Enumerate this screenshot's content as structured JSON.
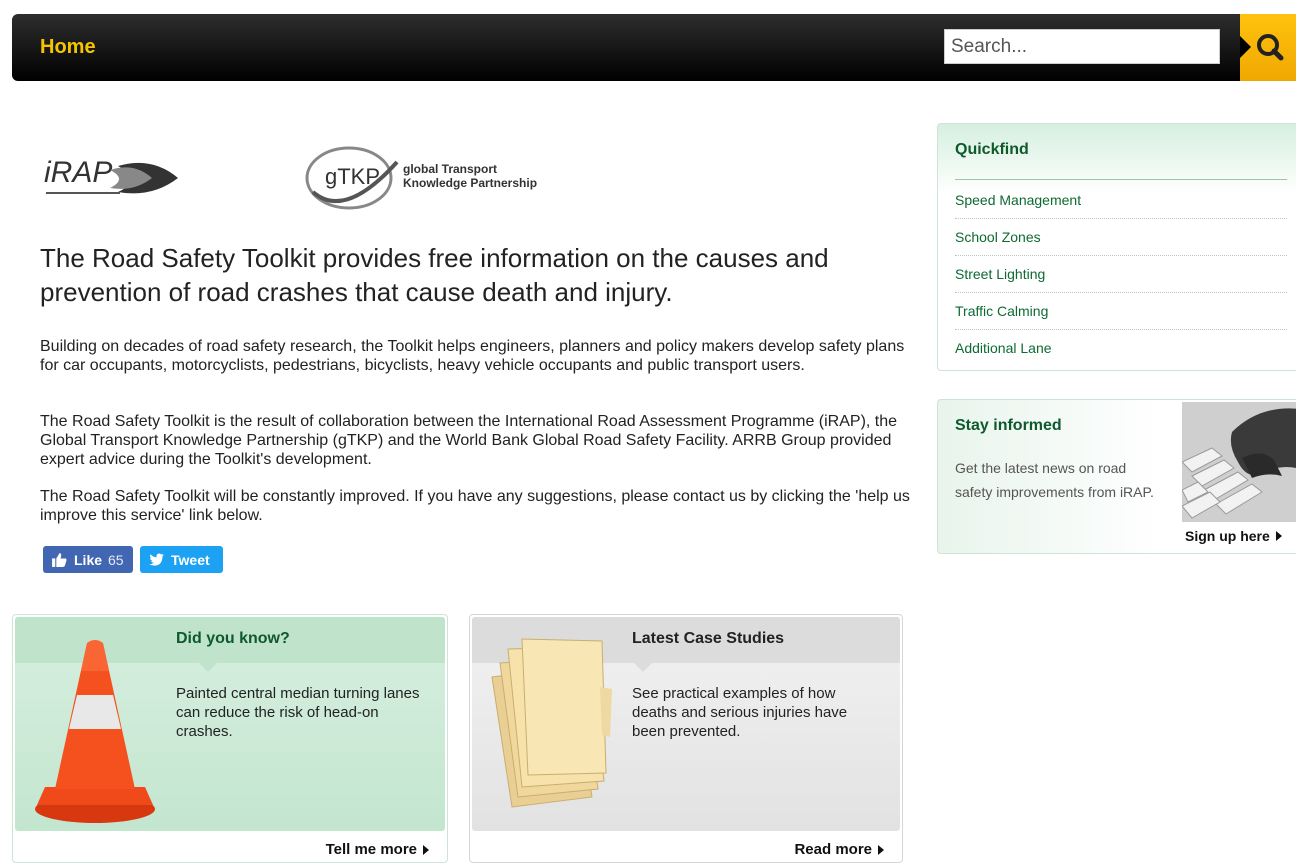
{
  "nav": {
    "home_label": "Home",
    "search_placeholder": "Search...",
    "accent_color": "#f5c400"
  },
  "logos": {
    "irap_text": "iRAP",
    "gtkp_mark": "gTKP",
    "gtkp_line1": "global Transport",
    "gtkp_line2": "Knowledge Partnership"
  },
  "intro": {
    "headline": "The Road Safety Toolkit provides free information on the causes and prevention of road crashes that cause death and injury.",
    "paragraphs": [
      "Building on decades of road safety research, the Toolkit helps engineers, planners and policy makers develop safety plans for car occupants, motorcyclists, pedestrians, bicyclists, heavy vehicle occupants and public transport users.",
      "The Road Safety Toolkit is the result of collaboration between the International Road Assessment Programme (iRAP), the Global Transport Knowledge Partnership (gTKP) and the World Bank Global Road Safety Facility. ARRB Group provided expert advice during the Toolkit's development.",
      "The Road Safety Toolkit will be constantly improved. If you have any suggestions, please contact us by clicking the 'help us improve this service' link below."
    ]
  },
  "social": {
    "like_label": "Like",
    "like_count": "65",
    "tweet_label": "Tweet"
  },
  "did_you_know": {
    "title": "Did you know?",
    "text": "Painted central median turning lanes can reduce the risk of head-on crashes.",
    "link": "Tell me more"
  },
  "case_studies": {
    "title": "Latest Case Studies",
    "text": "See practical examples of how deaths and serious injuries have been prevented.",
    "link": "Read more"
  },
  "quickfind": {
    "title": "Quickfind",
    "items": [
      "Speed Management",
      "School Zones",
      "Street Lighting",
      "Traffic Calming",
      "Additional Lane"
    ]
  },
  "stay_informed": {
    "title": "Stay informed",
    "text": "Get the latest news on road safety improvements from iRAP.",
    "link": "Sign up here"
  }
}
